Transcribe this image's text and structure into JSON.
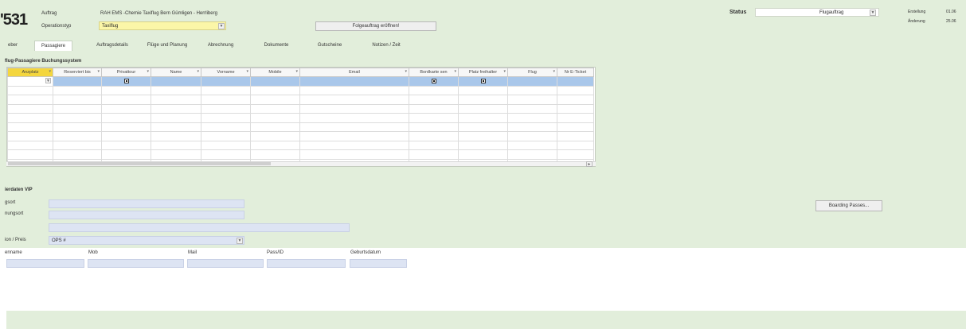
{
  "header": {
    "number": "531",
    "auftrag_label": "Auftrag",
    "auftrag_value": "RAH EMS -Chemie Taxiflug Bern Gümligen - Herrliberg",
    "operationstyp_label": "Operationstyp",
    "operationstyp_value": "Taxiflug",
    "folgeauftrag_button": "Folgeauftrag eröffnen!",
    "status_label": "Status",
    "status_value": "Flugauftrag",
    "erstellung_label": "Erstellung",
    "erstellung_value": "01.06",
    "anderung_label": "Änderung",
    "anderung_value": "25.06"
  },
  "tabs": [
    {
      "label": "eber",
      "active": false
    },
    {
      "label": "Passagiere",
      "active": true
    },
    {
      "label": "Auftragsdetails",
      "active": false
    },
    {
      "label": "Flüge und Planung",
      "active": false
    },
    {
      "label": "Abrechnung",
      "active": false
    },
    {
      "label": "Dokumente",
      "active": false
    },
    {
      "label": "Gutscheine",
      "active": false
    },
    {
      "label": "Notizen / Zeit",
      "active": false
    }
  ],
  "grid": {
    "title": "flug-Passagiere Buchungssystem",
    "columns": [
      "Anzplatz",
      "Reserviert bis",
      "Privattour",
      "Name",
      "Vorname",
      "Mobile",
      "Email",
      "Bordkarte sen",
      "Platz freihalter",
      "Flug",
      "Nr E-Ticket"
    ]
  },
  "vip": {
    "title": "ierdaten VIP",
    "field1_label": "gsort",
    "field2_label": "nungsort",
    "preis_label": "ion / Preis",
    "ops_value": "OPS #",
    "boarding_button": "Boarding Passes..."
  },
  "person_headers": [
    "enname",
    "Mob",
    "Mail",
    "Pass/ID",
    "Geburtsdatum"
  ],
  "colors": {
    "panel_green": "#e2eedb",
    "selection_blue": "#a9c7ea",
    "field_yellow": "#fbf6a8",
    "field_blue": "#dde4f3"
  }
}
